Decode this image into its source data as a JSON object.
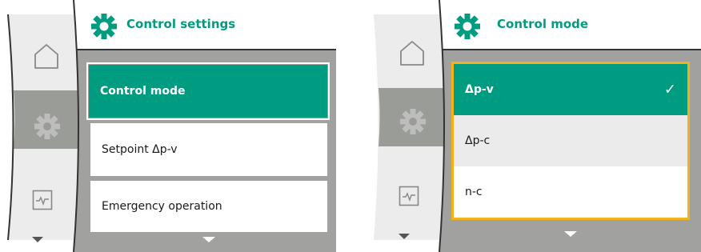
{
  "colors": {
    "accent": "#009c82",
    "focus_border": "#f0b31a",
    "screen_gray": "#a1a19f",
    "nav_active": "#9a9c98",
    "nav_bg": "#ececec"
  },
  "left_screen": {
    "title": "Control settings",
    "title_icon": "gear-icon",
    "nav": [
      "home-icon",
      "gear-icon",
      "diagnostics-icon",
      "scroll-down-icon"
    ],
    "menu": [
      {
        "label": "Control mode",
        "selected": true
      },
      {
        "label": "Setpoint Δp-v",
        "selected": false
      },
      {
        "label": "Emergency operation",
        "selected": false
      }
    ],
    "more_indicator": "scroll-down-icon"
  },
  "right_screen": {
    "title": "Control mode",
    "title_icon": "gear-icon",
    "nav": [
      "home-icon",
      "gear-icon",
      "diagnostics-icon",
      "scroll-down-icon"
    ],
    "options": [
      {
        "label": "Δp-v",
        "selected": true,
        "check": "✓"
      },
      {
        "label": "Δp-c",
        "selected": false
      },
      {
        "label": "n-c",
        "selected": false
      }
    ],
    "more_indicator": "scroll-down-icon"
  }
}
